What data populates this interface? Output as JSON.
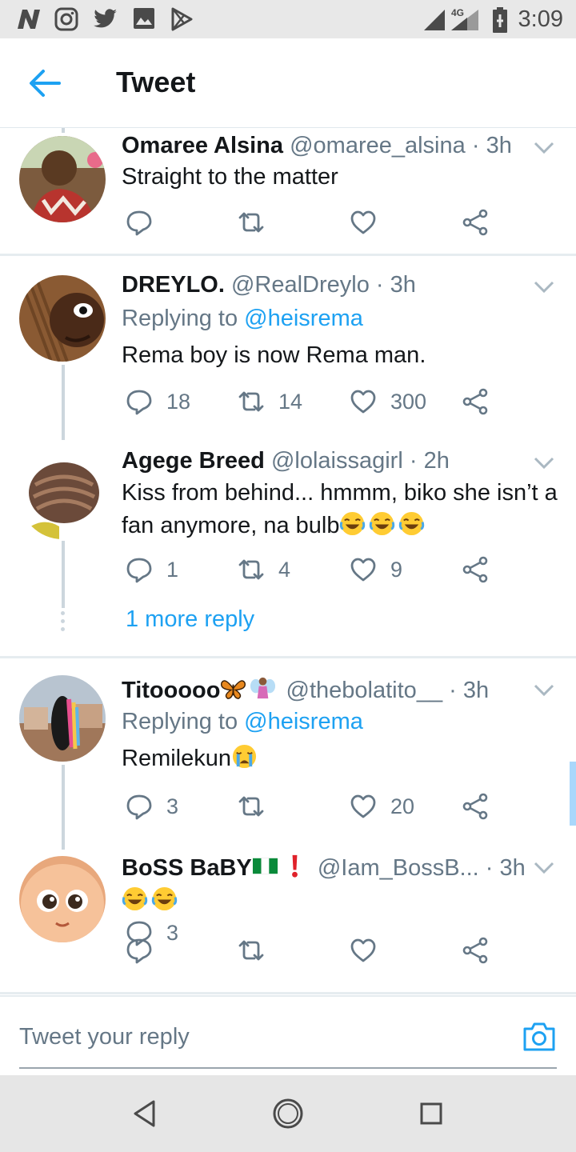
{
  "status_bar": {
    "time": "3:09",
    "network": "4G",
    "icons": [
      "n-icon",
      "instagram-icon",
      "twitter-icon",
      "gallery-icon",
      "play-store-icon",
      "signal-icon",
      "battery-icon"
    ]
  },
  "header": {
    "title": "Tweet"
  },
  "colors": {
    "accent": "#1da1f2",
    "secondary_text": "#657786",
    "divider": "#e6ecf0"
  },
  "tweets": [
    {
      "name": "Omaree Alsina",
      "handle": "@omaree_alsina",
      "dot": "·",
      "time": "3h",
      "body": "Straight to the matter",
      "replies": "",
      "retweets": "",
      "likes": ""
    },
    {
      "name": "DREYLO.",
      "handle": "@RealDreylo",
      "dot": "·",
      "time": "3h",
      "replying_prefix": "Replying to",
      "replying_to": "@heisrema",
      "body": "Rema boy is now Rema man.",
      "replies": "18",
      "retweets": "14",
      "likes": "300"
    },
    {
      "name": "Agege Breed",
      "handle": "@lolaissagirl",
      "dot": "·",
      "time": "2h",
      "body": "Kiss from behind... hmmm, biko she isn’t a fan anymore, na bulb",
      "emojis": [
        "laugh-cry-emoji",
        "laugh-cry-emoji",
        "laugh-cry-emoji"
      ],
      "replies": "1",
      "retweets": "4",
      "likes": "9",
      "more_replies": "1 more reply"
    },
    {
      "name": "Titooooo",
      "name_emojis": [
        "butterfly-emoji",
        "fairy-emoji"
      ],
      "handle": "@thebolatito__",
      "dot": "·",
      "time": "3h",
      "replying_prefix": "Replying to",
      "replying_to": "@heisrema",
      "body": "Remilekun",
      "emojis": [
        "crying-emoji"
      ],
      "replies": "3",
      "retweets": "",
      "likes": "20"
    },
    {
      "name": "BoSS BaBY",
      "name_emojis": [
        "nigeria-flag-emoji",
        "exclamation-emoji"
      ],
      "handle": "@Iam_BossB...",
      "dot": "·",
      "time": "3h",
      "body": "",
      "emojis": [
        "laugh-cry-emoji",
        "laugh-cry-emoji"
      ],
      "replies": "",
      "retweets": "",
      "likes": ""
    }
  ],
  "compose": {
    "placeholder": "Tweet your reply"
  },
  "navbar": {
    "icons": [
      "back-triangle-icon",
      "home-circle-icon",
      "recents-square-icon"
    ]
  }
}
